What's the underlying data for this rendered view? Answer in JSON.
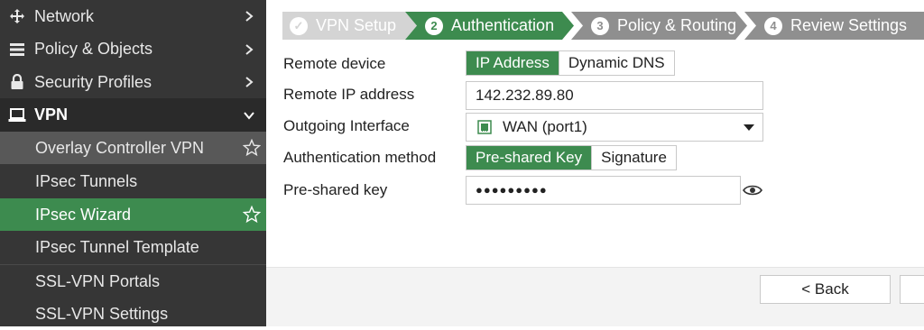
{
  "sidebar": {
    "items": [
      {
        "label": "Network",
        "icon": "network-icon"
      },
      {
        "label": "Policy & Objects",
        "icon": "policy-icon"
      },
      {
        "label": "Security Profiles",
        "icon": "lock-icon"
      },
      {
        "label": "VPN",
        "icon": "laptop-icon",
        "expanded": true
      },
      {
        "label": "Overlay Controller VPN"
      },
      {
        "label": "IPsec Tunnels"
      },
      {
        "label": "IPsec Wizard",
        "active": true
      },
      {
        "label": "IPsec Tunnel Template"
      },
      {
        "label": "SSL-VPN Portals"
      },
      {
        "label": "SSL-VPN Settings"
      }
    ]
  },
  "wizard": {
    "steps": [
      {
        "num": "✓",
        "label": "VPN Setup",
        "state": "done"
      },
      {
        "num": "2",
        "label": "Authentication",
        "state": "active"
      },
      {
        "num": "3",
        "label": "Policy & Routing",
        "state": "pending"
      },
      {
        "num": "4",
        "label": "Review Settings",
        "state": "pending"
      }
    ]
  },
  "form": {
    "remote_device": {
      "label": "Remote device",
      "options": [
        "IP Address",
        "Dynamic DNS"
      ],
      "selected": "IP Address"
    },
    "remote_ip": {
      "label": "Remote IP address",
      "value": "142.232.89.80"
    },
    "outgoing_interface": {
      "label": "Outgoing Interface",
      "value": "WAN (port1)"
    },
    "auth_method": {
      "label": "Authentication method",
      "options": [
        "Pre-shared Key",
        "Signature"
      ],
      "selected": "Pre-shared Key"
    },
    "psk": {
      "label": "Pre-shared key",
      "value": "●●●●●●●●●"
    }
  },
  "footer": {
    "back_label": "< Back"
  },
  "colors": {
    "sidebar_bg": "#363636",
    "active_green": "#3d8b4f",
    "step_done": "#d4d4d4",
    "step_pending": "#8f8f8f"
  }
}
